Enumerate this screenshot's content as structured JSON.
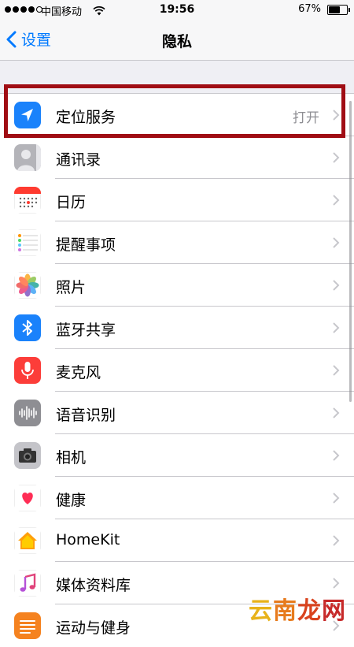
{
  "status_bar": {
    "carrier": "中国移动",
    "time": "19:56",
    "battery": "67%",
    "battery_level": 0.67
  },
  "nav": {
    "back_label": "设置",
    "title": "隐私"
  },
  "items": [
    {
      "label": "定位服务",
      "value": "打开",
      "icon": "location-arrow-icon",
      "color": "#1a82fb"
    },
    {
      "label": "通讯录",
      "value": "",
      "icon": "contacts-icon",
      "color": "#8e8e93"
    },
    {
      "label": "日历",
      "value": "",
      "icon": "calendar-icon",
      "color": "#ff3b30"
    },
    {
      "label": "提醒事项",
      "value": "",
      "icon": "reminders-icon",
      "color": "#ffffff"
    },
    {
      "label": "照片",
      "value": "",
      "icon": "photos-icon",
      "color": "#ffffff"
    },
    {
      "label": "蓝牙共享",
      "value": "",
      "icon": "bluetooth-icon",
      "color": "#1a82fb"
    },
    {
      "label": "麦克风",
      "value": "",
      "icon": "microphone-icon",
      "color": "#fc3d39"
    },
    {
      "label": "语音识别",
      "value": "",
      "icon": "speech-waveform-icon",
      "color": "#8e8e93"
    },
    {
      "label": "相机",
      "value": "",
      "icon": "camera-icon",
      "color": "#8e8e93"
    },
    {
      "label": "健康",
      "value": "",
      "icon": "health-heart-icon",
      "color": "#ffffff"
    },
    {
      "label": "HomeKit",
      "value": "",
      "icon": "home-icon",
      "color": "#ffffff"
    },
    {
      "label": "媒体资料库",
      "value": "",
      "icon": "music-note-icon",
      "color": "#ffffff"
    },
    {
      "label": "运动与健身",
      "value": "",
      "icon": "motion-icon",
      "color": "#f5821f"
    }
  ],
  "watermark": [
    "云",
    "南",
    "龙",
    "网"
  ],
  "highlight_color": "#a00d14",
  "accent": "#007aff"
}
